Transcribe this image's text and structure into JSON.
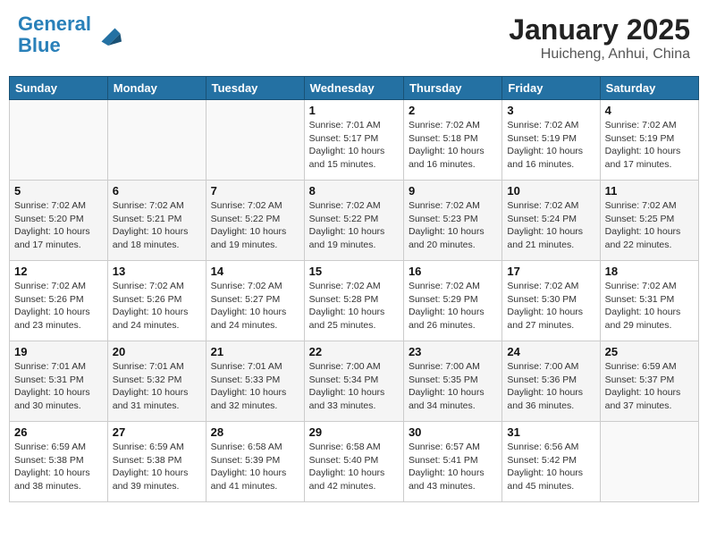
{
  "logo": {
    "line1": "General",
    "line2": "Blue"
  },
  "title": "January 2025",
  "subtitle": "Huicheng, Anhui, China",
  "weekdays": [
    "Sunday",
    "Monday",
    "Tuesday",
    "Wednesday",
    "Thursday",
    "Friday",
    "Saturday"
  ],
  "weeks": [
    [
      {
        "day": "",
        "info": ""
      },
      {
        "day": "",
        "info": ""
      },
      {
        "day": "",
        "info": ""
      },
      {
        "day": "1",
        "info": "Sunrise: 7:01 AM\nSunset: 5:17 PM\nDaylight: 10 hours\nand 15 minutes."
      },
      {
        "day": "2",
        "info": "Sunrise: 7:02 AM\nSunset: 5:18 PM\nDaylight: 10 hours\nand 16 minutes."
      },
      {
        "day": "3",
        "info": "Sunrise: 7:02 AM\nSunset: 5:19 PM\nDaylight: 10 hours\nand 16 minutes."
      },
      {
        "day": "4",
        "info": "Sunrise: 7:02 AM\nSunset: 5:19 PM\nDaylight: 10 hours\nand 17 minutes."
      }
    ],
    [
      {
        "day": "5",
        "info": "Sunrise: 7:02 AM\nSunset: 5:20 PM\nDaylight: 10 hours\nand 17 minutes."
      },
      {
        "day": "6",
        "info": "Sunrise: 7:02 AM\nSunset: 5:21 PM\nDaylight: 10 hours\nand 18 minutes."
      },
      {
        "day": "7",
        "info": "Sunrise: 7:02 AM\nSunset: 5:22 PM\nDaylight: 10 hours\nand 19 minutes."
      },
      {
        "day": "8",
        "info": "Sunrise: 7:02 AM\nSunset: 5:22 PM\nDaylight: 10 hours\nand 19 minutes."
      },
      {
        "day": "9",
        "info": "Sunrise: 7:02 AM\nSunset: 5:23 PM\nDaylight: 10 hours\nand 20 minutes."
      },
      {
        "day": "10",
        "info": "Sunrise: 7:02 AM\nSunset: 5:24 PM\nDaylight: 10 hours\nand 21 minutes."
      },
      {
        "day": "11",
        "info": "Sunrise: 7:02 AM\nSunset: 5:25 PM\nDaylight: 10 hours\nand 22 minutes."
      }
    ],
    [
      {
        "day": "12",
        "info": "Sunrise: 7:02 AM\nSunset: 5:26 PM\nDaylight: 10 hours\nand 23 minutes."
      },
      {
        "day": "13",
        "info": "Sunrise: 7:02 AM\nSunset: 5:26 PM\nDaylight: 10 hours\nand 24 minutes."
      },
      {
        "day": "14",
        "info": "Sunrise: 7:02 AM\nSunset: 5:27 PM\nDaylight: 10 hours\nand 24 minutes."
      },
      {
        "day": "15",
        "info": "Sunrise: 7:02 AM\nSunset: 5:28 PM\nDaylight: 10 hours\nand 25 minutes."
      },
      {
        "day": "16",
        "info": "Sunrise: 7:02 AM\nSunset: 5:29 PM\nDaylight: 10 hours\nand 26 minutes."
      },
      {
        "day": "17",
        "info": "Sunrise: 7:02 AM\nSunset: 5:30 PM\nDaylight: 10 hours\nand 27 minutes."
      },
      {
        "day": "18",
        "info": "Sunrise: 7:02 AM\nSunset: 5:31 PM\nDaylight: 10 hours\nand 29 minutes."
      }
    ],
    [
      {
        "day": "19",
        "info": "Sunrise: 7:01 AM\nSunset: 5:31 PM\nDaylight: 10 hours\nand 30 minutes."
      },
      {
        "day": "20",
        "info": "Sunrise: 7:01 AM\nSunset: 5:32 PM\nDaylight: 10 hours\nand 31 minutes."
      },
      {
        "day": "21",
        "info": "Sunrise: 7:01 AM\nSunset: 5:33 PM\nDaylight: 10 hours\nand 32 minutes."
      },
      {
        "day": "22",
        "info": "Sunrise: 7:00 AM\nSunset: 5:34 PM\nDaylight: 10 hours\nand 33 minutes."
      },
      {
        "day": "23",
        "info": "Sunrise: 7:00 AM\nSunset: 5:35 PM\nDaylight: 10 hours\nand 34 minutes."
      },
      {
        "day": "24",
        "info": "Sunrise: 7:00 AM\nSunset: 5:36 PM\nDaylight: 10 hours\nand 36 minutes."
      },
      {
        "day": "25",
        "info": "Sunrise: 6:59 AM\nSunset: 5:37 PM\nDaylight: 10 hours\nand 37 minutes."
      }
    ],
    [
      {
        "day": "26",
        "info": "Sunrise: 6:59 AM\nSunset: 5:38 PM\nDaylight: 10 hours\nand 38 minutes."
      },
      {
        "day": "27",
        "info": "Sunrise: 6:59 AM\nSunset: 5:38 PM\nDaylight: 10 hours\nand 39 minutes."
      },
      {
        "day": "28",
        "info": "Sunrise: 6:58 AM\nSunset: 5:39 PM\nDaylight: 10 hours\nand 41 minutes."
      },
      {
        "day": "29",
        "info": "Sunrise: 6:58 AM\nSunset: 5:40 PM\nDaylight: 10 hours\nand 42 minutes."
      },
      {
        "day": "30",
        "info": "Sunrise: 6:57 AM\nSunset: 5:41 PM\nDaylight: 10 hours\nand 43 minutes."
      },
      {
        "day": "31",
        "info": "Sunrise: 6:56 AM\nSunset: 5:42 PM\nDaylight: 10 hours\nand 45 minutes."
      },
      {
        "day": "",
        "info": ""
      }
    ]
  ]
}
